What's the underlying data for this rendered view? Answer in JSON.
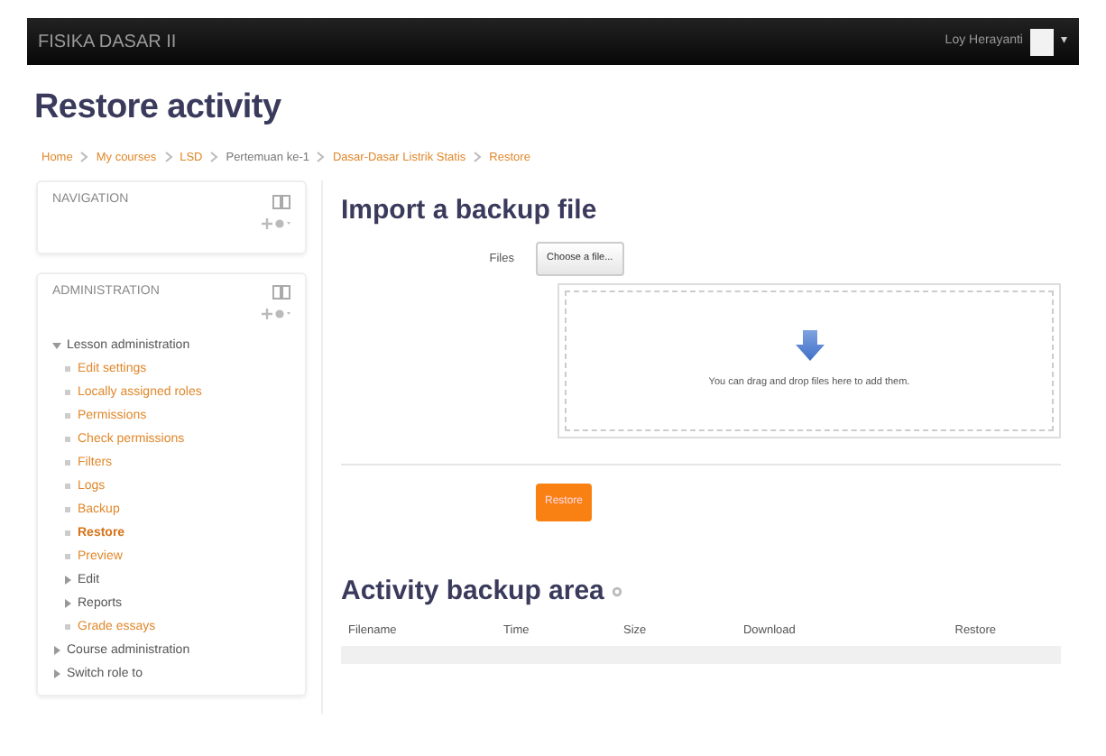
{
  "navbar": {
    "brand": "FISIKA DASAR II",
    "user": "Loy Herayanti",
    "menu_caret": "▾"
  },
  "page_title": "Restore activity",
  "breadcrumb": [
    {
      "label": "Home",
      "link": true
    },
    {
      "label": "My courses",
      "link": true
    },
    {
      "label": "LSD",
      "link": true
    },
    {
      "label": "Pertemuan ke-1",
      "link": false
    },
    {
      "label": "Dasar-Dasar Listrik Statis",
      "link": true
    },
    {
      "label": "Restore",
      "link": true
    }
  ],
  "blocks": [
    {
      "title": "NAVIGATION"
    },
    {
      "title": "ADMINISTRATION",
      "items": [
        {
          "label": "Lesson administration",
          "kind": "branch",
          "expanded": true,
          "current": false,
          "children": [
            {
              "label": "Edit settings",
              "kind": "leaf",
              "current": false
            },
            {
              "label": "Locally assigned roles",
              "kind": "leaf",
              "current": false
            },
            {
              "label": "Permissions",
              "kind": "leaf",
              "current": false
            },
            {
              "label": "Check permissions",
              "kind": "leaf",
              "current": false
            },
            {
              "label": "Filters",
              "kind": "leaf",
              "current": false
            },
            {
              "label": "Logs",
              "kind": "leaf",
              "current": false
            },
            {
              "label": "Backup",
              "kind": "leaf",
              "current": false
            },
            {
              "label": "Restore",
              "kind": "leaf",
              "current": true
            },
            {
              "label": "Preview",
              "kind": "leaf",
              "current": false
            },
            {
              "label": "Edit",
              "kind": "branch",
              "expanded": false,
              "current": false
            },
            {
              "label": "Reports",
              "kind": "branch",
              "expanded": false,
              "current": false
            },
            {
              "label": "Grade essays",
              "kind": "leaf",
              "current": false
            }
          ]
        },
        {
          "label": "Course administration",
          "kind": "branch",
          "expanded": false,
          "current": false
        },
        {
          "label": "Switch role to",
          "kind": "branch",
          "expanded": false,
          "current": false
        }
      ]
    }
  ],
  "import": {
    "heading": "Import a backup file",
    "files_label": "Files",
    "choose_button": "Choose a file...",
    "drop_hint": "You can drag and drop files here to add them.",
    "submit": "Restore"
  },
  "backup_area": {
    "heading": "Activity backup area",
    "columns": [
      "Filename",
      "Time",
      "Size",
      "Download",
      "Restore"
    ]
  }
}
